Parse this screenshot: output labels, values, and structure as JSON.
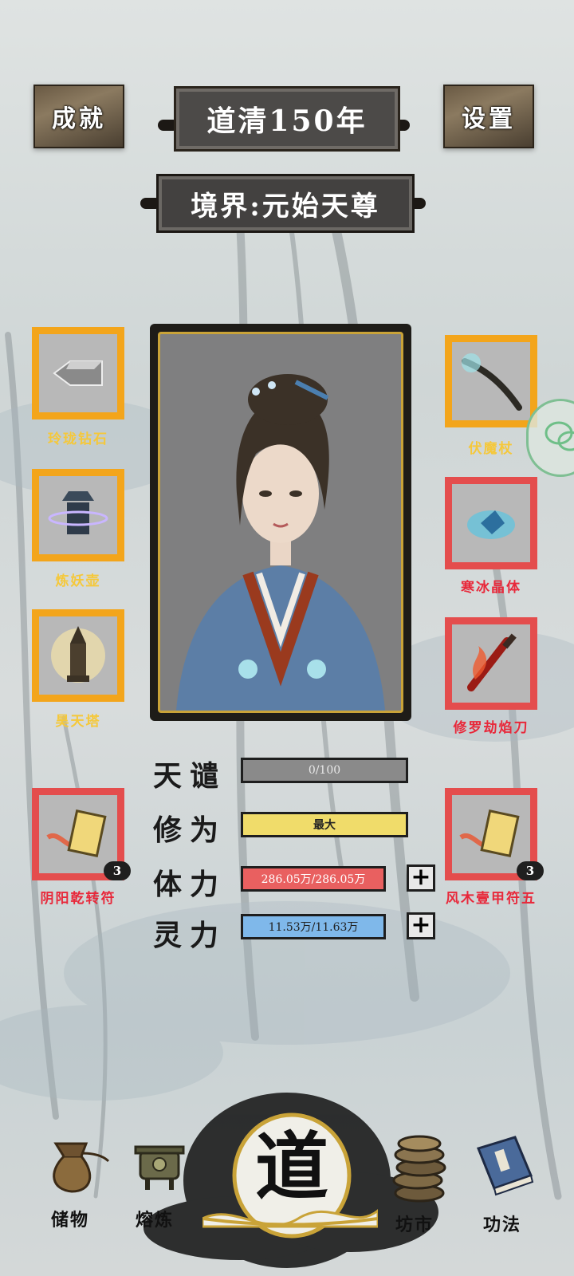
{
  "header": {
    "achievements_label": "成就",
    "settings_label": "设置",
    "year_title": "道清150年",
    "realm_title": "境界:元始天尊"
  },
  "left_slots": [
    {
      "label": "玲珑钻石",
      "rarity": "gold"
    },
    {
      "label": "炼妖壶",
      "rarity": "gold"
    },
    {
      "label": "昊天塔",
      "rarity": "gold"
    }
  ],
  "right_slots": [
    {
      "label": "伏魔杖",
      "rarity": "gold"
    },
    {
      "label": "寒冰晶体",
      "rarity": "red"
    },
    {
      "label": "修罗劫焰刀",
      "rarity": "red"
    }
  ],
  "talismans": [
    {
      "label": "阴阳乾转符",
      "count": "3"
    },
    {
      "label": "风木壹甲符五",
      "count": "3"
    }
  ],
  "stats": {
    "tribulation": {
      "label": "天谴",
      "value": "0/100"
    },
    "cultivation": {
      "label": "修为",
      "value": "最大"
    },
    "stamina": {
      "label": "体力",
      "value": "286.05万/286.05万"
    },
    "spirit": {
      "label": "灵力",
      "value": "11.53万/11.63万"
    }
  },
  "nav": {
    "storage": "储物",
    "smelt": "熔炼",
    "dao": "道",
    "market": "坊市",
    "skills": "功法"
  },
  "colors": {
    "gold_frame": "#f3a51b",
    "red_frame": "#e44d4d",
    "gold_text": "#f5c83a",
    "red_text": "#e8283a",
    "cultivation_bar": "#f0dc6a",
    "stamina_bar": "#e96060",
    "spirit_bar": "#7fb8ea",
    "tribulation_bar": "#8a8a8a"
  },
  "icons": [
    "achievement-icon",
    "settings-icon",
    "diamond-icon",
    "cauldron-icon",
    "pagoda-icon",
    "staff-icon",
    "ice-crystal-icon",
    "flame-blade-icon",
    "talisman-icon",
    "plus-icon",
    "pouch-icon",
    "furnace-icon",
    "dao-icon",
    "coins-icon",
    "book-icon",
    "wechat-icon"
  ]
}
